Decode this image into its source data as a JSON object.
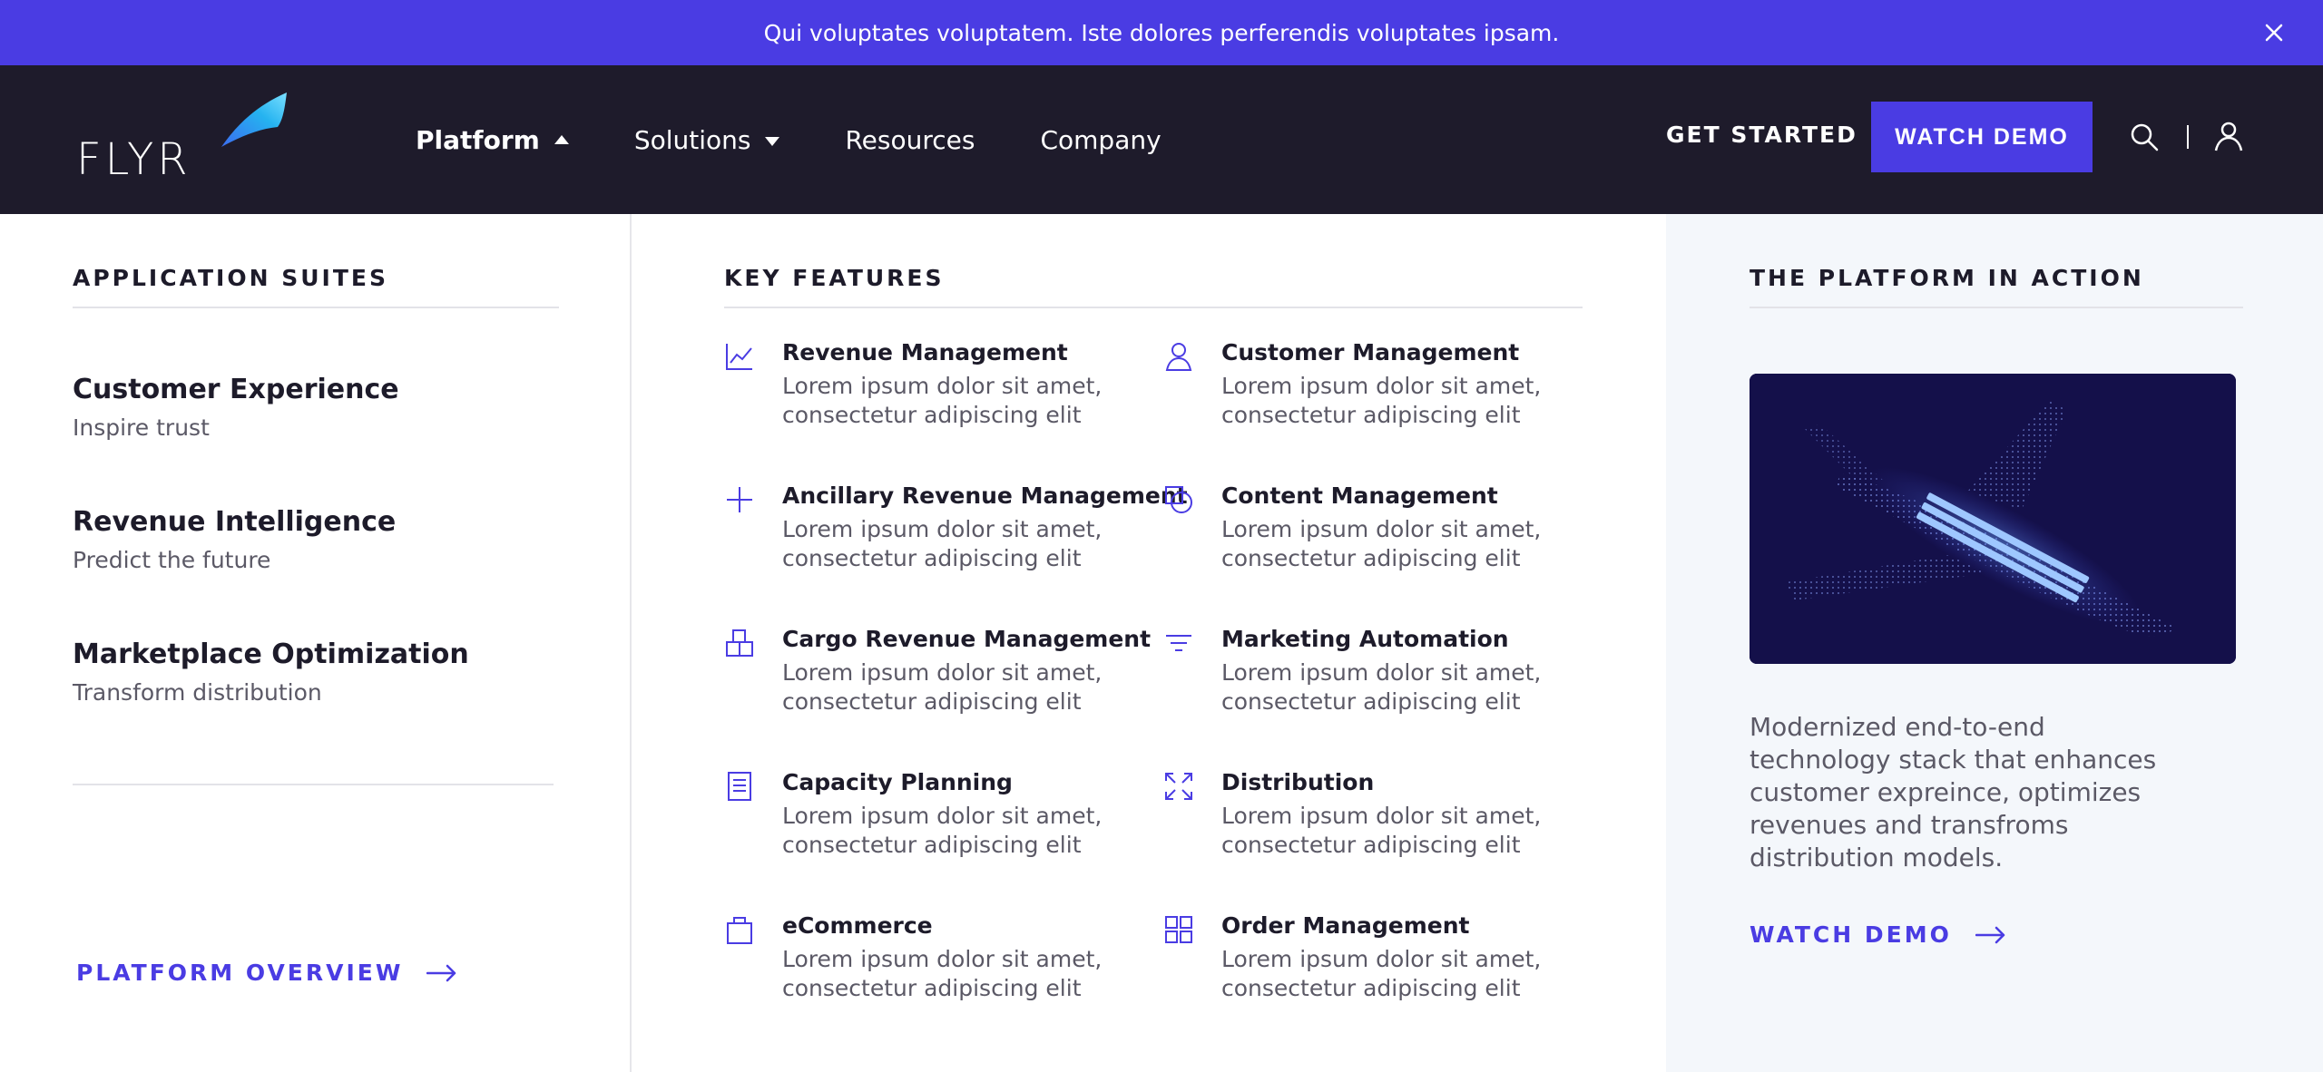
{
  "banner": {
    "text": "Qui voluptates voluptatem. Iste dolores perferendis voluptates ipsam."
  },
  "nav": {
    "logo_text": "FLYR",
    "menu": [
      {
        "label": "Platform",
        "caret": "up"
      },
      {
        "label": "Solutions",
        "caret": "down"
      },
      {
        "label": "Resources"
      },
      {
        "label": "Company"
      }
    ],
    "get_started": "GET STARTED",
    "watch_demo": "WATCH DEMO"
  },
  "suites": {
    "title": "APPLICATION SUITES",
    "items": [
      {
        "name": "Customer Experience",
        "sub": "Inspire trust"
      },
      {
        "name": "Revenue Intelligence",
        "sub": "Predict the future"
      },
      {
        "name": "Marketplace Optimization",
        "sub": "Transform distribution"
      }
    ],
    "cta": "PLATFORM OVERVIEW"
  },
  "features": {
    "title": "KEY FEATURES",
    "items": [
      {
        "title": "Revenue Management",
        "desc": "Lorem ipsum dolor sit amet, consectetur adipiscing elit",
        "icon": "chart-line-icon"
      },
      {
        "title": "Customer Management",
        "desc": "Lorem ipsum dolor sit amet, consectetur adipiscing elit",
        "icon": "user-icon"
      },
      {
        "title": "Ancillary Revenue Management",
        "desc": "Lorem ipsum dolor sit amet, consectetur adipiscing elit",
        "icon": "plus-icon"
      },
      {
        "title": "Content Management",
        "desc": "Lorem ipsum dolor sit amet, consectetur adipiscing elit",
        "icon": "shapes-icon"
      },
      {
        "title": "Cargo Revenue Management",
        "desc": "Lorem ipsum dolor sit amet, consectetur adipiscing elit",
        "icon": "boxes-icon"
      },
      {
        "title": "Marketing Automation",
        "desc": "Lorem ipsum dolor sit amet, consectetur adipiscing elit",
        "icon": "filter-icon"
      },
      {
        "title": "Capacity Planning",
        "desc": "Lorem ipsum dolor sit amet, consectetur adipiscing elit",
        "icon": "document-icon"
      },
      {
        "title": "Distribution",
        "desc": "Lorem ipsum dolor sit amet, consectetur adipiscing elit",
        "icon": "expand-icon"
      },
      {
        "title": "eCommerce",
        "desc": "Lorem ipsum dolor sit amet, consectetur adipiscing elit",
        "icon": "shopping-bag-icon"
      },
      {
        "title": "Order Management",
        "desc": "Lorem ipsum dolor sit amet, consectetur adipiscing elit",
        "icon": "grid-icon"
      }
    ]
  },
  "action": {
    "title": "THE PLATFORM IN ACTION",
    "blurb": "Modernized end-to-end technology stack that enhances customer expreince, optimizes revenues and transfroms distribution models.",
    "cta": "WATCH DEMO"
  },
  "colors": {
    "accent": "#4a3ce3",
    "nav_bg": "#1e1b2b",
    "panel_bg": "#f4f7fb"
  }
}
